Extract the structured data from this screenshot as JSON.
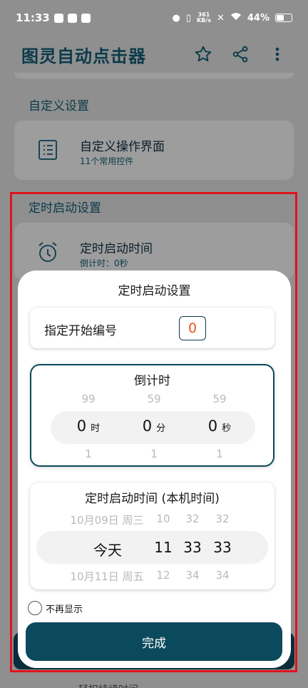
{
  "status_bar": {
    "time": "11:33",
    "net_speed_value": "361",
    "net_speed_unit": "KB/s",
    "battery": "44%"
  },
  "app_bar": {
    "title": "图灵自动点击器"
  },
  "background": {
    "section1_title": "自定义设置",
    "custom_ui": {
      "title": "自定义操作界面",
      "subtitle": "11个常用控件"
    },
    "section2_title": "定时启动设置",
    "timed_start": {
      "title": "定时启动时间",
      "subtitle": "倒计时：0秒"
    },
    "peek_text": "轻扣持续时间"
  },
  "dialog": {
    "title": "定时启动设置",
    "start_number": {
      "label": "指定开始编号",
      "value": "0"
    },
    "countdown": {
      "title": "倒计时",
      "columns": [
        {
          "above": "99",
          "value": "0",
          "unit": "时",
          "below": "1"
        },
        {
          "above": "59",
          "value": "0",
          "unit": "分",
          "below": "1"
        },
        {
          "above": "59",
          "value": "0",
          "unit": "秒",
          "below": "1"
        }
      ]
    },
    "scheduled": {
      "title": "定时启动时间 (本机时间)",
      "above": {
        "date": "10月09日 周三",
        "hour": "10",
        "minute": "32",
        "second": "32"
      },
      "selected": {
        "date": "今天",
        "hour": "11",
        "minute": "33",
        "second": "33"
      },
      "below": {
        "date": "10月11日 周五",
        "hour": "12",
        "minute": "34",
        "second": "34"
      }
    },
    "dont_show_again": "不再显示",
    "done_label": "完成"
  },
  "colors": {
    "primary": "#0b4a5c",
    "accent_value": "#e8541b",
    "highlight": "#e0141e"
  }
}
